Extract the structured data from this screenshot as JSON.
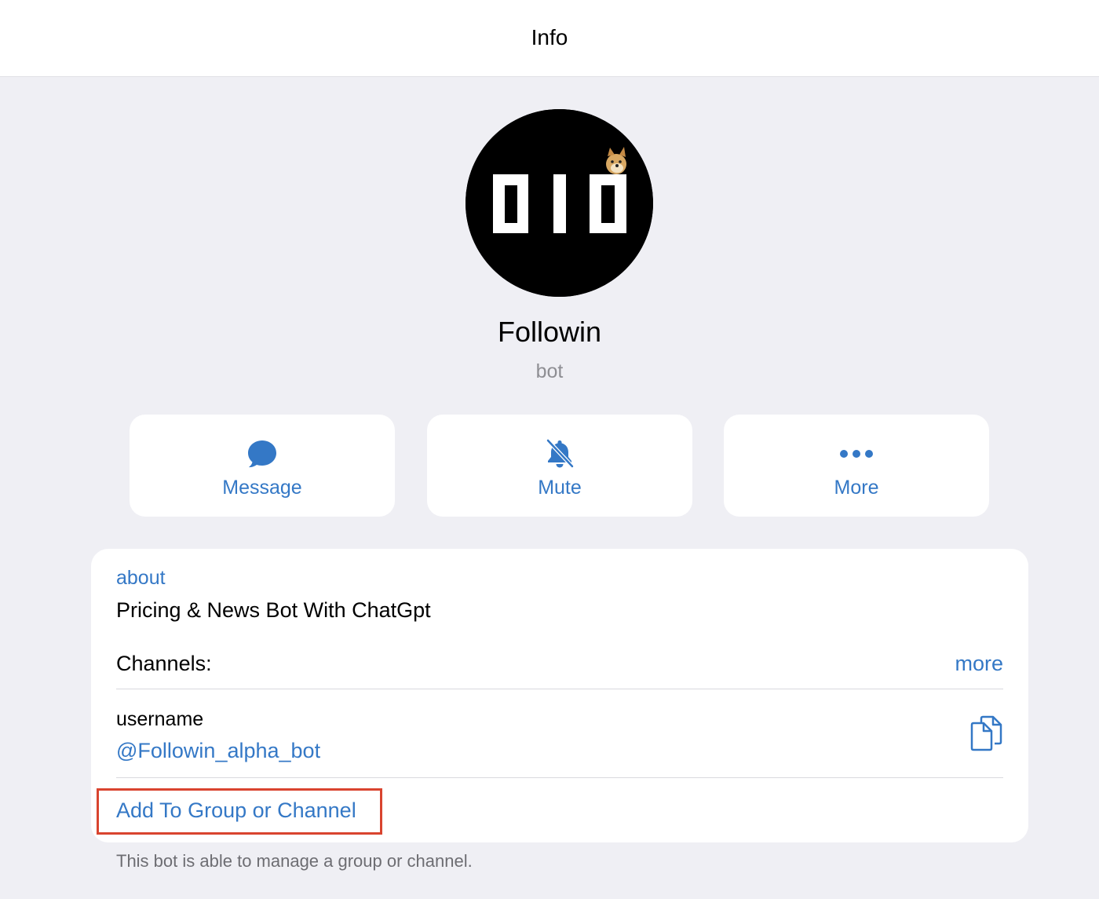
{
  "header": {
    "title": "Info"
  },
  "profile": {
    "avatar_icon": "followin-logo-avatar",
    "name": "Followin",
    "subtitle": "bot"
  },
  "actions": [
    {
      "label": "Message",
      "icon": "message-bubble-icon"
    },
    {
      "label": "Mute",
      "icon": "bell-slash-icon"
    },
    {
      "label": "More",
      "icon": "ellipsis-icon"
    }
  ],
  "info": {
    "about_label": "about",
    "about_value": "Pricing & News Bot With ChatGpt",
    "channels_label": "Channels:",
    "channels_more": "more",
    "username_label": "username",
    "username_value": "@Followin_alpha_bot",
    "copy_icon": "copy-icon",
    "add_group_label": "Add To Group or Channel"
  },
  "footer": {
    "note": "This bot is able to manage a group or channel."
  },
  "colors": {
    "accent": "#3478c6",
    "highlight": "#d9442f",
    "background": "#efeff4"
  }
}
